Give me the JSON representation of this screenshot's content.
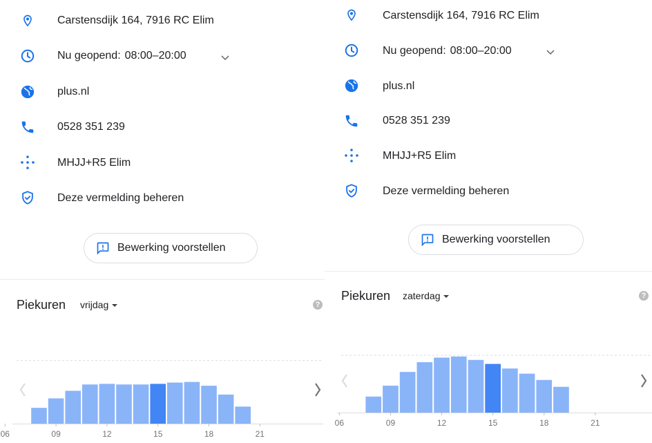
{
  "colors": {
    "icon_blue": "#1a73e8",
    "bar": "#8ab4f8",
    "bar_current": "#4285f4",
    "text": "#202124",
    "muted": "#70757a"
  },
  "panels": [
    {
      "address": "Carstensdijk 164, 7916 RC Elim",
      "hours_status": "Nu geopend:",
      "hours_time": "08:00–20:00",
      "website": "plus.nl",
      "phone": "0528 351 239",
      "plus_code": "MHJJ+R5 Elim",
      "manage_listing": "Deze vermelding beheren",
      "suggest_edit": "Bewerking voorstellen",
      "peak_title": "Piekuren",
      "day": "vrijdag",
      "help": "?",
      "chart_data": {
        "type": "bar",
        "title": "Piekuren",
        "day": "vrijdag",
        "x_tick_labels": [
          "06",
          "09",
          "12",
          "15",
          "18",
          "21"
        ],
        "hours": [
          8,
          9,
          10,
          11,
          12,
          13,
          14,
          15,
          16,
          17,
          18,
          19,
          20
        ],
        "values": [
          25,
          40,
          52,
          62,
          63,
          62,
          62,
          63,
          65,
          66,
          60,
          46,
          27
        ],
        "current_hour": 15,
        "ylim": [
          0,
          105
        ],
        "dashed_reference": 100
      }
    },
    {
      "address": "Carstensdijk 164, 7916 RC Elim",
      "hours_status": "Nu geopend:",
      "hours_time": "08:00–20:00",
      "website": "plus.nl",
      "phone": "0528 351 239",
      "plus_code": "MHJJ+R5 Elim",
      "manage_listing": "Deze vermelding beheren",
      "suggest_edit": "Bewerking voorstellen",
      "peak_title": "Piekuren",
      "day": "zaterdag",
      "help": "?",
      "chart_data": {
        "type": "bar",
        "title": "Piekuren",
        "day": "zaterdag",
        "x_tick_labels": [
          "06",
          "09",
          "12",
          "15",
          "18",
          "21"
        ],
        "hours": [
          8,
          9,
          10,
          11,
          12,
          13,
          14,
          15,
          16,
          17,
          18,
          19
        ],
        "values": [
          28,
          47,
          71,
          88,
          96,
          98,
          92,
          85,
          77,
          68,
          57,
          45
        ],
        "current_hour": 15,
        "ylim": [
          0,
          105
        ],
        "dashed_reference": 100
      }
    }
  ]
}
